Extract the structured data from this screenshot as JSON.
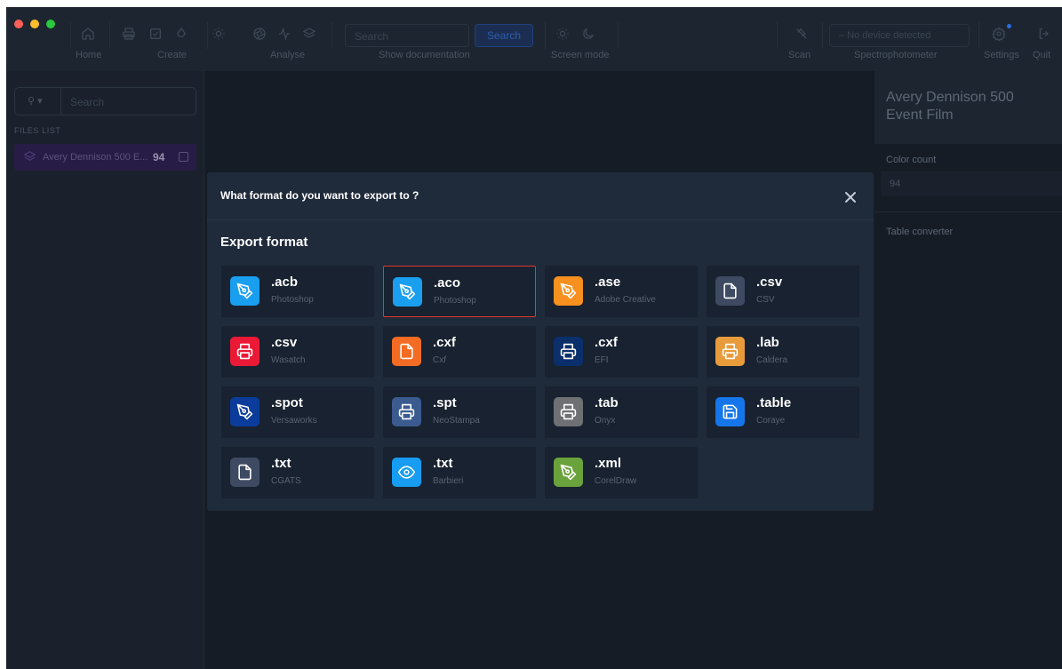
{
  "toolbar": {
    "labels": {
      "home": "Home",
      "create": "Create",
      "analyse": "Analyse",
      "show_documentation": "Show documentation",
      "screen_mode": "Screen mode",
      "scan": "Scan",
      "spectrophotometer": "Spectrophotometer",
      "settings": "Settings",
      "quit": "Quit"
    },
    "search_placeholder": "Search",
    "search_button": "Search",
    "device_status": "No device detected",
    "traffic_lights": {
      "close": "#fe5f57",
      "minimize": "#febc2e",
      "zoom": "#28c840"
    }
  },
  "sidebar": {
    "search_placeholder": "Search",
    "files_list_label": "FILES LIST",
    "files": [
      {
        "name": "Avery Dennison 500 E...",
        "count": "94"
      }
    ]
  },
  "right_panel": {
    "title": "Avery Dennison 500 Event Film",
    "color_count_label": "Color count",
    "color_count_value": "94",
    "table_converter_label": "Table converter"
  },
  "modal": {
    "title": "What format do you want to export to ?",
    "section_title": "Export format",
    "selected_color": "#e0392b",
    "formats": [
      {
        "ext": ".acb",
        "sub": "Photoshop",
        "icon": "pen-tool-icon",
        "color": "#1a9ff0",
        "selected": false
      },
      {
        "ext": ".aco",
        "sub": "Photoshop",
        "icon": "pen-tool-icon",
        "color": "#1a9ff0",
        "selected": true
      },
      {
        "ext": ".ase",
        "sub": "Adobe Creative",
        "icon": "pen-tool-icon",
        "color": "#f7901e",
        "selected": false
      },
      {
        "ext": ".csv",
        "sub": "CSV",
        "icon": "file-icon",
        "color": "#3d4a61",
        "selected": false
      },
      {
        "ext": ".csv",
        "sub": "Wasatch",
        "icon": "printer-icon",
        "color": "#ea1a36",
        "selected": false
      },
      {
        "ext": ".cxf",
        "sub": "Cxf",
        "icon": "file-icon",
        "color": "#f46b23",
        "selected": false
      },
      {
        "ext": ".cxf",
        "sub": "EFI",
        "icon": "printer-icon",
        "color": "#0a2f6b",
        "selected": false
      },
      {
        "ext": ".lab",
        "sub": "Caldera",
        "icon": "printer-icon",
        "color": "#e89b3b",
        "selected": false
      },
      {
        "ext": ".spot",
        "sub": "Versaworks",
        "icon": "pen-tool-icon",
        "color": "#0b3c9c",
        "selected": false
      },
      {
        "ext": ".spt",
        "sub": "NeoStampa",
        "icon": "printer-icon",
        "color": "#3b5b8f",
        "selected": false
      },
      {
        "ext": ".tab",
        "sub": "Onyx",
        "icon": "printer-icon",
        "color": "#6e7073",
        "selected": false
      },
      {
        "ext": ".table",
        "sub": "Coraye",
        "icon": "save-icon",
        "color": "#1575ea",
        "selected": false
      },
      {
        "ext": ".txt",
        "sub": "CGATS",
        "icon": "file-icon",
        "color": "#3d4a61",
        "selected": false
      },
      {
        "ext": ".txt",
        "sub": "Barbieri",
        "icon": "eye-icon",
        "color": "#169cf0",
        "selected": false
      },
      {
        "ext": ".xml",
        "sub": "CorelDraw",
        "icon": "pen-tool-icon",
        "color": "#6aa23b",
        "selected": false
      }
    ]
  }
}
